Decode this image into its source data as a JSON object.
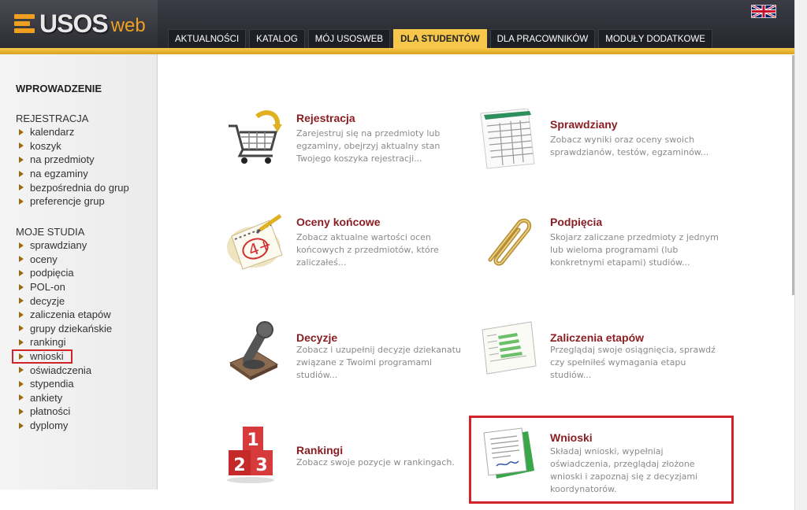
{
  "header": {
    "logo": {
      "main": "USOS",
      "suffix": "web"
    },
    "tabs": [
      {
        "label": "AKTUALNOŚCI",
        "active": false
      },
      {
        "label": "KATALOG",
        "active": false
      },
      {
        "label": "MÓJ USOSWEB",
        "active": false
      },
      {
        "label": "DLA STUDENTÓW",
        "active": true
      },
      {
        "label": "DLA PRACOWNIKÓW",
        "active": false
      },
      {
        "label": "MODUŁY DODATKOWE",
        "active": false
      }
    ],
    "language_icon": "uk-flag-icon"
  },
  "sidebar": {
    "heading": "WPROWADZENIE",
    "sections": [
      {
        "title": "REJESTRACJA",
        "items": [
          "kalendarz",
          "koszyk",
          "na przedmioty",
          "na egzaminy",
          "bezpośrednia do grup",
          "preferencje grup"
        ]
      },
      {
        "title": "MOJE STUDIA",
        "items": [
          "sprawdziany",
          "oceny",
          "podpięcia",
          "POL-on",
          "decyzje",
          "zaliczenia etapów",
          "grupy dziekańskie",
          "rankingi",
          "wnioski",
          "oświadczenia",
          "stypendia",
          "ankiety",
          "płatności",
          "dyplomy"
        ]
      }
    ]
  },
  "tiles": [
    {
      "title": "Rejestracja",
      "desc": "Zarejestruj się na przedmioty lub egzaminy, obejrzyj aktualny stan Twojego koszyka rejestracji...",
      "icon": "shopping-cart-icon"
    },
    {
      "title": "Sprawdziany",
      "desc": "Zobacz wyniki oraz oceny swoich sprawdzianów, testów, egzaminów...",
      "icon": "test-sheet-icon"
    },
    {
      "title": "Oceny końcowe",
      "desc": "Zobacz aktualne wartości ocen końcowych z przedmiotów, które zaliczałeś...",
      "icon": "grade-notebook-icon"
    },
    {
      "title": "Podpięcia",
      "desc": "Skojarz zaliczane przedmioty z jednym lub wieloma programami (lub konkretnymi etapami) studiów...",
      "icon": "paperclip-icon"
    },
    {
      "title": "Decyzje",
      "desc": "Zobacz i uzupełnij decyzje dziekanatu związane z Twoimi programami studiów...",
      "icon": "stamp-icon"
    },
    {
      "title": "Zaliczenia etapów",
      "desc": "Przeglądaj swoje osiągnięcia, sprawdź czy spełniłeś wymagania etapu studiów...",
      "icon": "spreadsheet-icon"
    },
    {
      "title": "Rankingi",
      "desc": "Zobacz swoje pozycje w rankingach.",
      "icon": "ranking-podium-icon"
    },
    {
      "title": "Wnioski",
      "desc": "Składaj wnioski, wypełniaj oświadczenia, przeglądaj złożone wnioski i zapoznaj się z decyzjami koordynatorów.",
      "icon": "application-document-icon"
    }
  ],
  "colors": {
    "accent": "#f6c74a",
    "title_red": "#8b1e22",
    "highlight": "#d2232a"
  }
}
